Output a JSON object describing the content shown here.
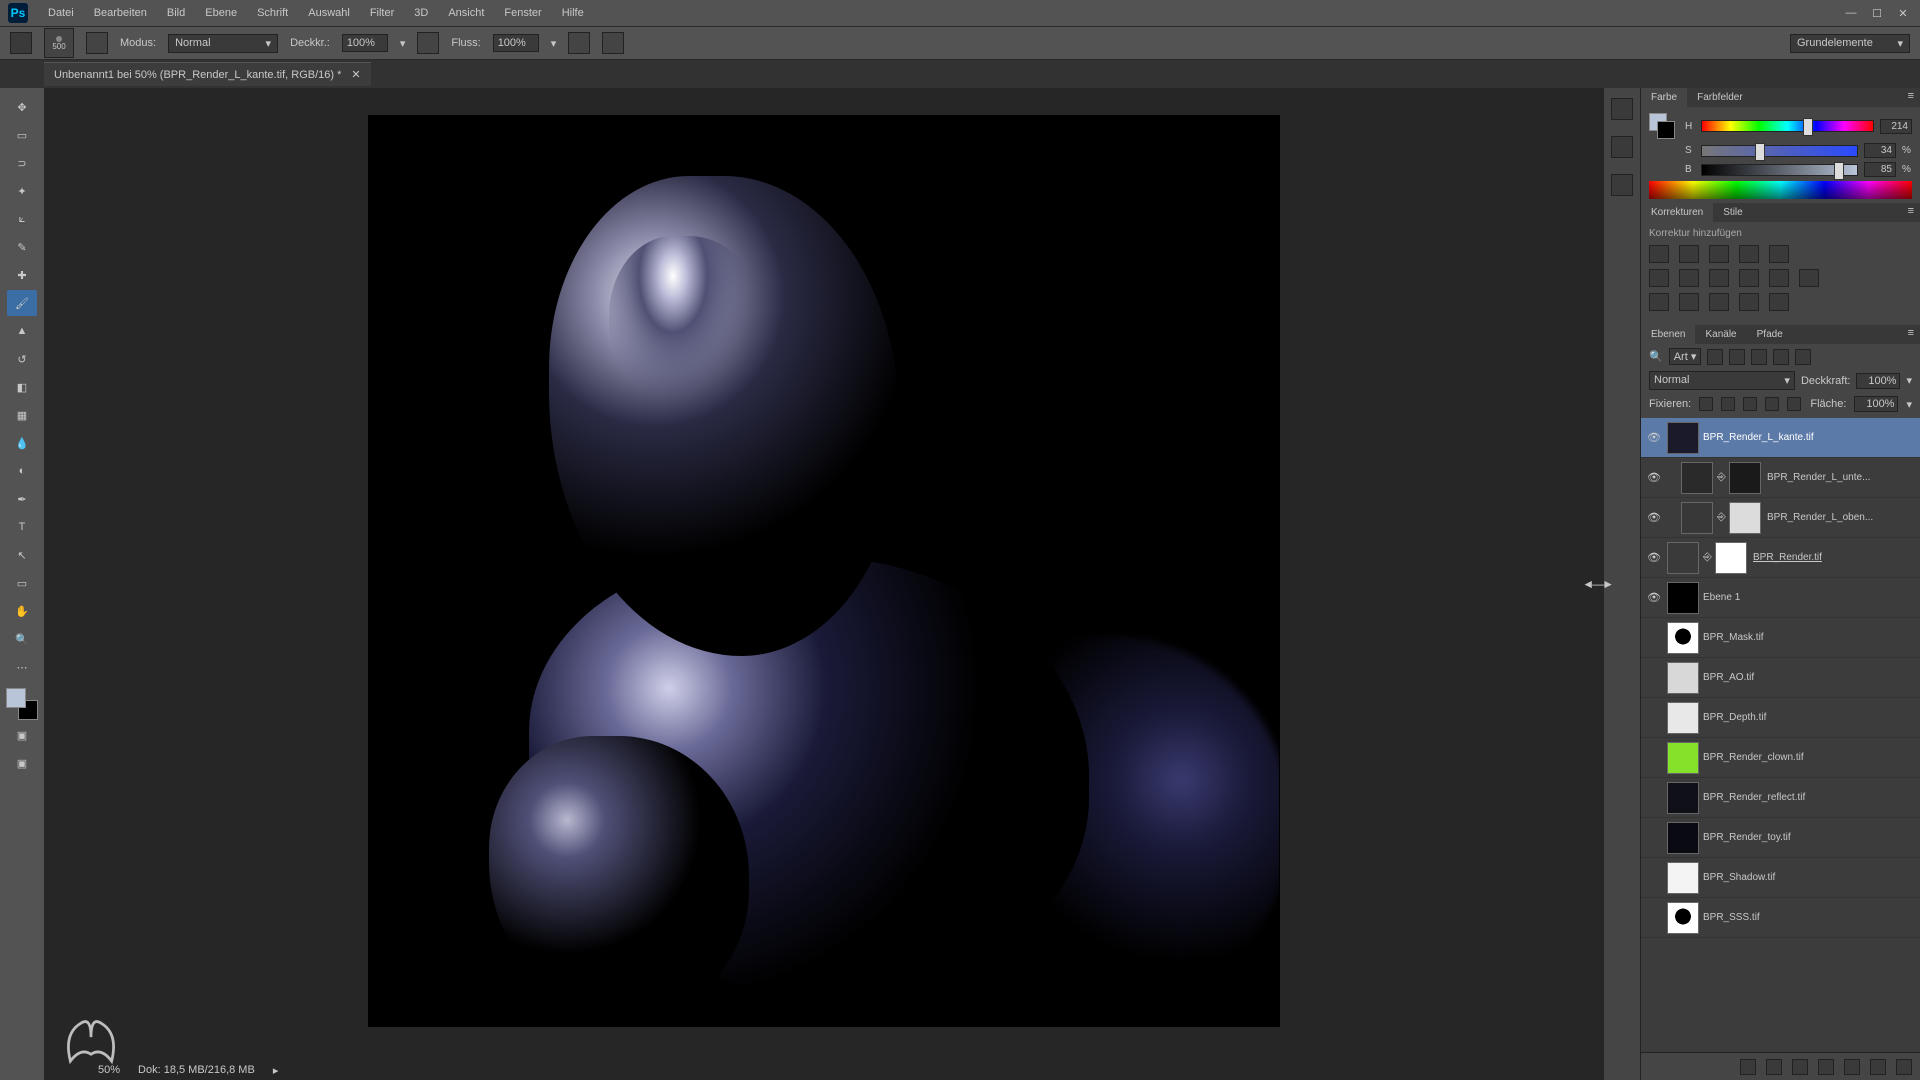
{
  "menu": [
    "Datei",
    "Bearbeiten",
    "Bild",
    "Ebene",
    "Schrift",
    "Auswahl",
    "Filter",
    "3D",
    "Ansicht",
    "Fenster",
    "Hilfe"
  ],
  "options": {
    "brush_size": "500",
    "mode_label": "Modus:",
    "mode_value": "Normal",
    "opacity_label": "Deckkr.:",
    "opacity_value": "100%",
    "flow_label": "Fluss:",
    "flow_value": "100%",
    "preset_label": "Grundelemente"
  },
  "doc_tab": "Unbenannt1 bei 50% (BPR_Render_L_kante.tif, RGB/16) *",
  "tools": [
    {
      "name": "move-tool",
      "glyph": "✥"
    },
    {
      "name": "marquee-tool",
      "glyph": "▭"
    },
    {
      "name": "lasso-tool",
      "glyph": "⊃"
    },
    {
      "name": "wand-tool",
      "glyph": "✦"
    },
    {
      "name": "crop-tool",
      "glyph": "⟀"
    },
    {
      "name": "eyedropper-tool",
      "glyph": "✎"
    },
    {
      "name": "healing-tool",
      "glyph": "✚"
    },
    {
      "name": "brush-tool",
      "glyph": "🖌",
      "active": true
    },
    {
      "name": "stamp-tool",
      "glyph": "▲"
    },
    {
      "name": "history-brush-tool",
      "glyph": "↺"
    },
    {
      "name": "eraser-tool",
      "glyph": "◧"
    },
    {
      "name": "gradient-tool",
      "glyph": "▦"
    },
    {
      "name": "blur-tool",
      "glyph": "💧"
    },
    {
      "name": "dodge-tool",
      "glyph": "◐"
    },
    {
      "name": "pen-tool",
      "glyph": "✒"
    },
    {
      "name": "type-tool",
      "glyph": "T"
    },
    {
      "name": "path-tool",
      "glyph": "↖"
    },
    {
      "name": "shape-tool",
      "glyph": "▭"
    },
    {
      "name": "hand-tool",
      "glyph": "✋"
    },
    {
      "name": "zoom-tool",
      "glyph": "🔍"
    },
    {
      "name": "more-tool",
      "glyph": "⋯"
    }
  ],
  "color_panel": {
    "tabs": [
      "Farbe",
      "Farbfelder"
    ],
    "h_label": "H",
    "h_val": "214",
    "s_label": "S",
    "s_val": "34",
    "b_label": "B",
    "b_val": "85",
    "pct": "%"
  },
  "korr_panel": {
    "tabs": [
      "Korrekturen",
      "Stile"
    ],
    "hint": "Korrektur hinzufügen"
  },
  "layers_panel": {
    "tabs": [
      "Ebenen",
      "Kanäle",
      "Pfade"
    ],
    "filter_label": "Art",
    "blend_mode": "Normal",
    "opacity_label": "Deckkraft:",
    "opacity_value": "100%",
    "lock_label": "Fixieren:",
    "fill_label": "Fläche:",
    "fill_value": "100%",
    "layers": [
      {
        "vis": true,
        "indent": 0,
        "thumb": "#1a1a2a",
        "name": "BPR_Render_L_kante.tif",
        "link": false,
        "mask": null,
        "sel": true
      },
      {
        "vis": true,
        "indent": 1,
        "thumb": "#2a2a2a",
        "name": "BPR_Render_L_unte...",
        "link": true,
        "mask": "#1a1a1a"
      },
      {
        "vis": true,
        "indent": 1,
        "thumb": "#383838",
        "name": "BPR_Render_L_oben...",
        "link": true,
        "mask": "#dcdcdc"
      },
      {
        "vis": true,
        "indent": 0,
        "thumb": "#3a3a3a",
        "name": "BPR_Render.tif",
        "link": true,
        "mask": "#ffffff",
        "underline": true
      },
      {
        "vis": true,
        "indent": 0,
        "thumb": "#000000",
        "name": "Ebene 1",
        "link": false,
        "mask": null
      },
      {
        "vis": false,
        "indent": 0,
        "thumb": "#ffffff",
        "name": "BPR_Mask.tif",
        "thumbstyle": "silhouette"
      },
      {
        "vis": false,
        "indent": 0,
        "thumb": "#d8d8d8",
        "name": "BPR_AO.tif"
      },
      {
        "vis": false,
        "indent": 0,
        "thumb": "#e8e8e8",
        "name": "BPR_Depth.tif"
      },
      {
        "vis": false,
        "indent": 0,
        "thumb": "#84e22a",
        "name": "BPR_Render_clown.tif"
      },
      {
        "vis": false,
        "indent": 0,
        "thumb": "#101018",
        "name": "BPR_Render_reflect.tif"
      },
      {
        "vis": false,
        "indent": 0,
        "thumb": "#0a0a12",
        "name": "BPR_Render_toy.tif"
      },
      {
        "vis": false,
        "indent": 0,
        "thumb": "#f4f4f4",
        "name": "BPR_Shadow.tif"
      },
      {
        "vis": false,
        "indent": 0,
        "thumb": "#ffffff",
        "name": "BPR_SSS.tif",
        "thumbstyle": "silhouette"
      }
    ]
  },
  "status": {
    "zoom": "50%",
    "doc": "Dok: 18,5 MB/216,8 MB"
  }
}
